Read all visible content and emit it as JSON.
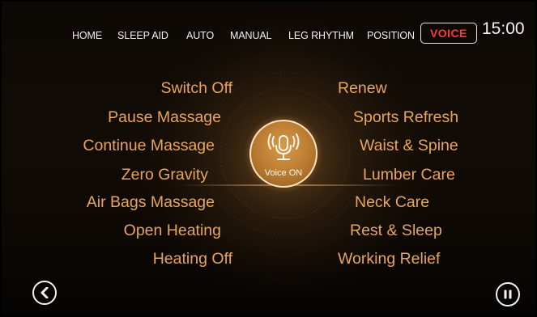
{
  "nav": {
    "items": [
      "HOME",
      "SLEEP AID",
      "AUTO",
      "MANUAL",
      "LEG RHYTHM",
      "POSITION"
    ],
    "active": "VOICE",
    "clock": "15:00"
  },
  "commands": {
    "left": [
      "Switch Off",
      "Pause Massage",
      "Continue Massage",
      "Zero Gravity",
      "Air  Bags Massage",
      "Open Heating",
      "Heating Off"
    ],
    "right": [
      "Renew",
      "Sports Refresh",
      "Waist & Spine",
      "Lumber Care",
      "Neck Care",
      "Rest & Sleep",
      "Working Relief"
    ]
  },
  "voice_button": {
    "label": "Voice ON",
    "icon": "microphone-icon"
  },
  "controls": {
    "back_icon": "chevron-left-icon",
    "pause_icon": "pause-icon"
  },
  "colors": {
    "accent": "#e9a55c",
    "active_tab": "#ff3b2f",
    "mic_gold": "#c4883a"
  }
}
